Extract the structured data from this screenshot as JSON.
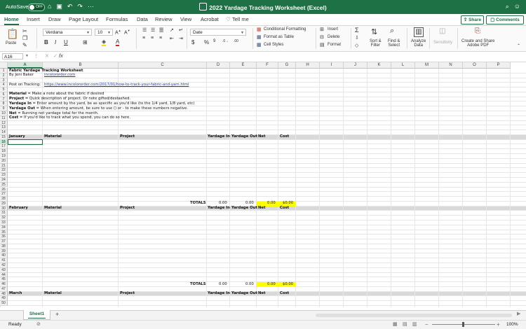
{
  "app": {
    "autosave_label": "AutoSave",
    "autosave_state": "OFF",
    "title": "2022 Yardage Tracking Worksheet (Excel)"
  },
  "menu_tabs": [
    "Home",
    "Insert",
    "Draw",
    "Page Layout",
    "Formulas",
    "Data",
    "Review",
    "View",
    "Acrobat",
    "Tell me"
  ],
  "share_label": "Share",
  "comments_label": "Comments",
  "ribbon": {
    "paste": "Paste",
    "font_name": "Verdana",
    "font_size": "10",
    "number_format": "Date",
    "conditional_formatting": "Conditional Formatting",
    "format_as_table": "Format as Table",
    "cell_styles": "Cell Styles",
    "insert": "Insert",
    "delete": "Delete",
    "format": "Format",
    "sort_filter": [
      "Sort &",
      "Filter"
    ],
    "find_select": [
      "Find &",
      "Select"
    ],
    "analyze_data": [
      "Analyze",
      "Data"
    ],
    "sensitivity": "Sensitivity",
    "create_share": [
      "Create and Share",
      "Adobe PDF"
    ]
  },
  "formula_bar": {
    "name_box": "A16",
    "fx": "fx"
  },
  "columns": [
    "A",
    "B",
    "C",
    "D",
    "E",
    "F",
    "G",
    "H",
    "I",
    "J",
    "K",
    "L",
    "M",
    "N",
    "O",
    "P"
  ],
  "selected_column": "A",
  "selected_row": "16",
  "row_numbers": [
    "1",
    "2",
    "3",
    "4",
    "5",
    "6",
    "7",
    "8",
    "9",
    "10",
    "11",
    "12",
    "13",
    "14",
    "15",
    "16",
    "17",
    "18",
    "19",
    "20",
    "21",
    "22",
    "23",
    "24",
    "25",
    "26",
    "27",
    "28",
    "29",
    "30",
    "31",
    "32",
    "33",
    "34",
    "35",
    "36",
    "37",
    "38",
    "39",
    "40",
    "41",
    "42",
    "43",
    "44",
    "45",
    "46",
    "47",
    "48",
    "49",
    "50"
  ],
  "sheet": {
    "title": "Fabric Yardage Tracking Worksheet",
    "by": "By Jeni Baker",
    "by_link": "incolororder.com",
    "post_label": "Post on Tracking:",
    "post_url": "https://www.incolororder.com/2017/01/how-to-track-your-fabric-and-yarn.html",
    "notes": [
      {
        "k": "Material",
        "v": " = Make a note about the fabric if desired"
      },
      {
        "k": "Project",
        "v": " = Quick description of project.  Or note gifted/destashed."
      },
      {
        "k": "Yardage In",
        "v": " = Enter amount by the yard, be as specific as you'd like (to the 1/4 yard, 1/8 yard, etc)"
      },
      {
        "k": "Yardage Out",
        "v": " = When entering amount, be sure to use () or - to make these numbers negative."
      },
      {
        "k": "Net",
        "v": " = Running net yardage total for the month."
      },
      {
        "k": "Cost",
        "v": " = If you'd like to track what you spend, you can do so here."
      }
    ],
    "headers": [
      "Material",
      "Project",
      "Yardage In",
      "Yardage Out",
      "Net",
      "Cost"
    ],
    "months": [
      {
        "name": "January",
        "row": "15",
        "totals_row": "29",
        "totals_label": "TOTALS",
        "yin": "0.00",
        "yout": "0.00",
        "net": "0.00",
        "cost": "$0.00"
      },
      {
        "name": "February",
        "row": "30",
        "totals_row": "46",
        "totals_label": "TOTALS",
        "yin": "0.00",
        "yout": "0.00",
        "net": "0.00",
        "cost": "$0.00"
      },
      {
        "name": "March",
        "row": "48"
      }
    ]
  },
  "sheet_tabs": [
    "Sheet1"
  ],
  "status": {
    "ready": "Ready",
    "zoom": "100%"
  },
  "colors": {
    "excel_green": "#1e7145",
    "header_band": "#d9d9d9",
    "highlight": "#ffff00"
  }
}
